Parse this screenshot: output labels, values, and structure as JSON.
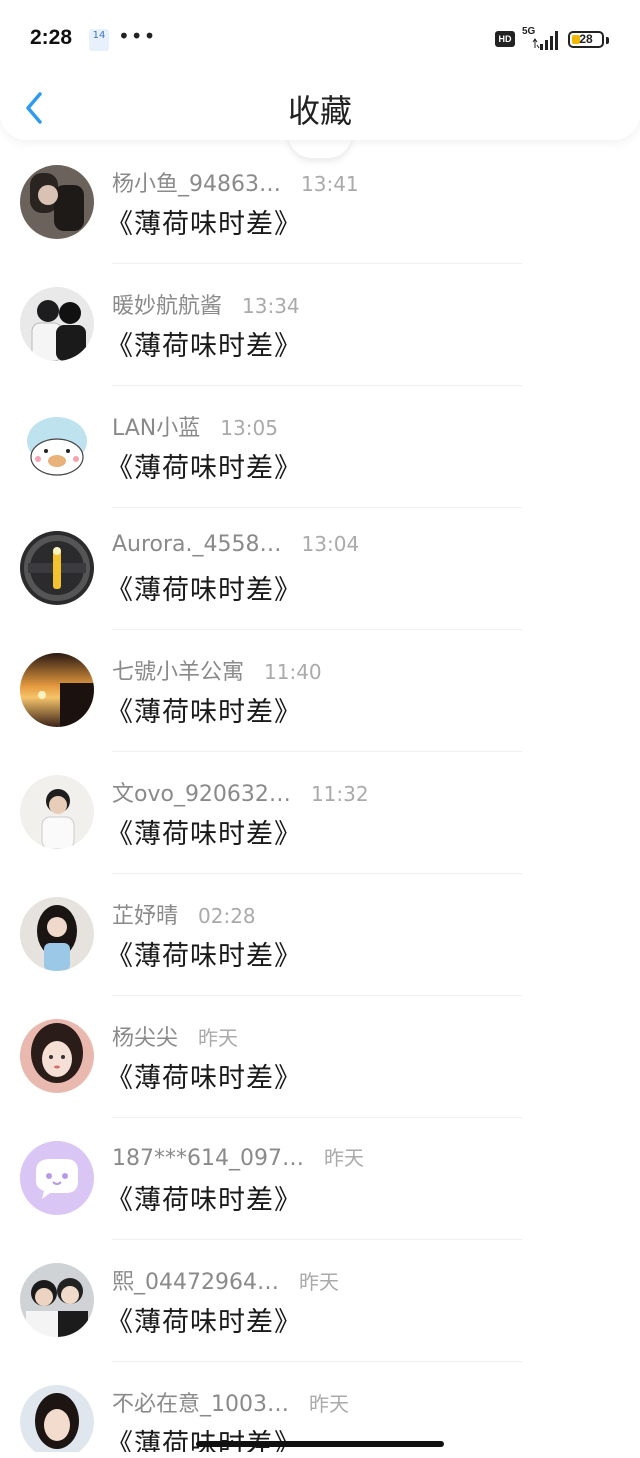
{
  "status_bar": {
    "time": "2:28",
    "badge": "14",
    "dots": "•••",
    "hd": "HD",
    "network": "5G",
    "battery": "28"
  },
  "header": {
    "title": "收藏",
    "back_icon": "chevron-left-icon",
    "accent_color": "#2f9bf0"
  },
  "items": [
    {
      "name": "杨小鱼_94863…",
      "time": "13:41",
      "message": "《薄荷味时差》"
    },
    {
      "name": "暖妙航航酱",
      "time": "13:34",
      "message": "《薄荷味时差》"
    },
    {
      "name": "LAN小蓝",
      "time": "13:05",
      "message": "《薄荷味时差》"
    },
    {
      "name": "Aurora._4558…",
      "time": "13:04",
      "message": "《薄荷味时差》"
    },
    {
      "name": "七號小羊公寓",
      "time": "11:40",
      "message": "《薄荷味时差》"
    },
    {
      "name": "文ovo_920632…",
      "time": "11:32",
      "message": "《薄荷味时差》"
    },
    {
      "name": "芷妤晴",
      "time": "02:28",
      "message": "《薄荷味时差》"
    },
    {
      "name": "杨尖尖",
      "time": "昨天",
      "message": "《薄荷味时差》"
    },
    {
      "name": "187***614_097…",
      "time": "昨天",
      "message": "《薄荷味时差》"
    },
    {
      "name": "熙_04472964…",
      "time": "昨天",
      "message": "《薄荷味时差》"
    },
    {
      "name": "不必在意_1003…",
      "time": "昨天",
      "message": "《薄荷味时差》"
    }
  ]
}
